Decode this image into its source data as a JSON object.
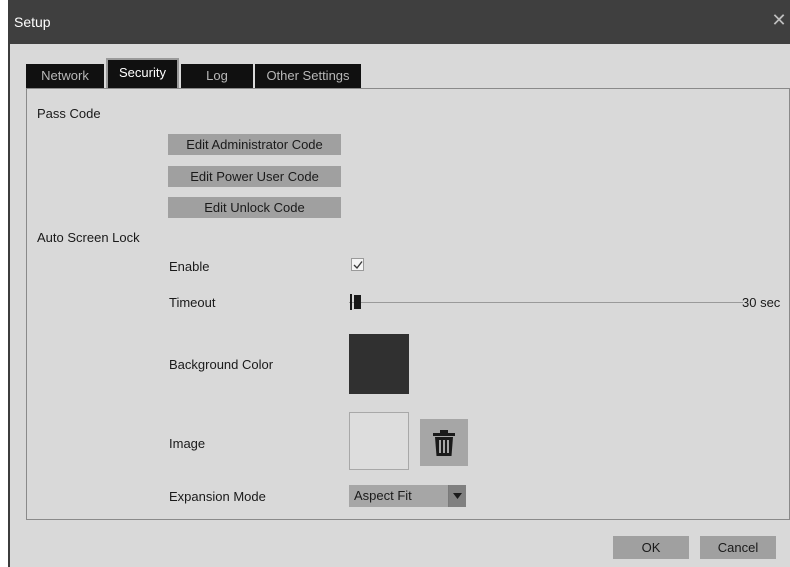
{
  "window": {
    "title": "Setup",
    "close_glyph": "✕"
  },
  "tabs": [
    {
      "label": "Network",
      "active": false
    },
    {
      "label": "Security",
      "active": true
    },
    {
      "label": "Log",
      "active": false
    },
    {
      "label": "Other Settings",
      "active": false
    }
  ],
  "pass_code": {
    "label": "Pass Code",
    "buttons": [
      "Edit Administrator Code",
      "Edit Power User Code",
      "Edit Unlock Code"
    ]
  },
  "auto_screen_lock": {
    "label": "Auto Screen Lock",
    "enable": {
      "label": "Enable",
      "checked": true
    },
    "timeout": {
      "label": "Timeout",
      "value": "30 sec"
    },
    "background_color": {
      "label": "Background Color",
      "color": "#303030"
    },
    "image": {
      "label": "Image",
      "delete_icon": "trash-icon"
    },
    "expansion_mode": {
      "label": "Expansion Mode",
      "value": "Aspect Fit",
      "arrow_icon": "caret-down-icon"
    }
  },
  "footer": {
    "ok_label": "OK",
    "cancel_label": "Cancel"
  },
  "colors": {
    "titlebar": "#3f3f3f",
    "dialog_bg": "#d9d9d9",
    "tab_bg": "#101010",
    "button_bg": "#a0a0a0"
  }
}
